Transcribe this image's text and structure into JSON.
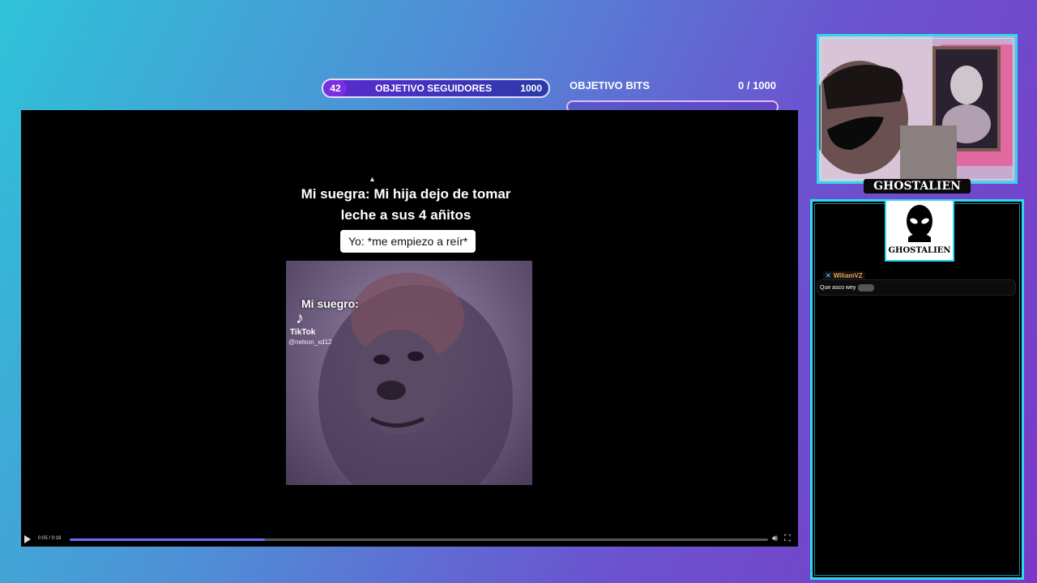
{
  "follower_goal": {
    "current": "42",
    "label": "OBJETIVO SEGUIDORES",
    "target": "1000"
  },
  "bits_goal": {
    "title": "OBJETIVO BITS",
    "count": "0 / 1000",
    "progress": 0
  },
  "video": {
    "caption_line1": "Mi suegra: Mi hija dejo de tomar",
    "caption_line2": "leche a sus 4 añitos",
    "reply": "Yo: *me empiezo a reír*",
    "clip_caption": "Mi suegro:",
    "tiktok_label": "TikTok",
    "tiktok_handle": "@nelson_xd12",
    "timecode": "0:05 / 0:18",
    "progress": 0.28
  },
  "streamer": {
    "name": "GHOSTALIEN"
  },
  "chat": {
    "logo_label": "GHOSTALIEN",
    "messages": [
      {
        "user": "WiliamVZ",
        "text": "Que asco wey"
      }
    ]
  },
  "colors": {
    "accent": "#2fd8ee",
    "goal_purple": "#7a2fe0"
  }
}
